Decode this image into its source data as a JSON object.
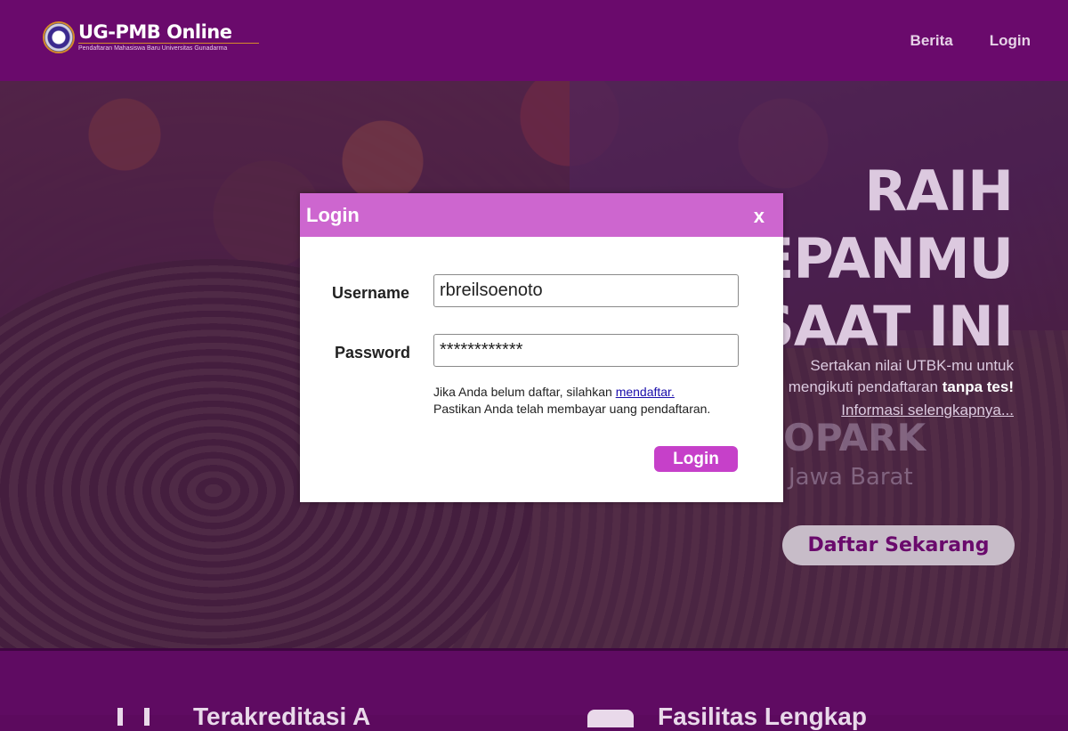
{
  "header": {
    "logo_title": "UG-PMB Online",
    "logo_subtitle": "Pendaftaran Mahasiswa Baru Universitas Gunadarma",
    "nav": [
      {
        "label": "Berita"
      },
      {
        "label": "Login"
      }
    ]
  },
  "hero": {
    "heading_line1": "RAIH",
    "heading_line2": "DEPANMU",
    "heading_line3": "SAAT INI",
    "sub_text": "Sertakan nilai UTBK-mu untuk",
    "sub_text2": "mengikuti pendaftaran",
    "sub_bold": "tanpa tes!",
    "info_link": "Informasi selengkapnya...",
    "bg_text1": "OPARK",
    "bg_text2": "Jawa Barat",
    "cta_button": "Daftar Sekarang"
  },
  "features": {
    "item1": "Terakreditasi A",
    "item2": "Fasilitas Lengkap"
  },
  "modal": {
    "title": "Login",
    "close": "x",
    "username_label": "Username",
    "username_value": "rbreilsoenoto",
    "password_label": "Password",
    "password_value": "************",
    "help_prefix": "Jika Anda belum daftar, silahkan",
    "help_link": "mendaftar.",
    "help_line2": "Pastikan Anda telah membayar uang pendaftaran.",
    "login_button": "Login"
  },
  "colors": {
    "header": "#6a0a6c",
    "modal_header": "#cd66cf",
    "login_button": "#c640c9"
  }
}
